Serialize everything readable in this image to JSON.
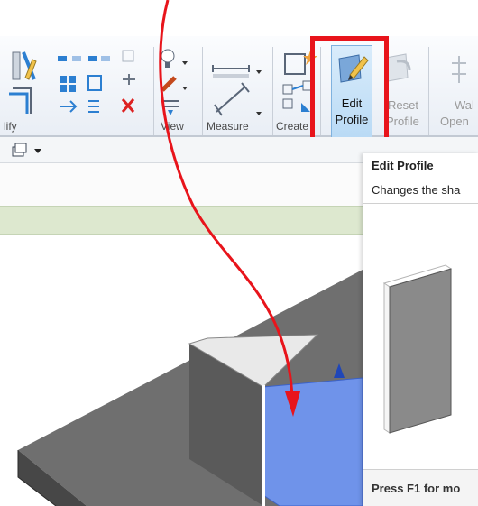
{
  "ribbon": {
    "panels": [
      {
        "label": "lify"
      },
      {
        "label": "View"
      },
      {
        "label": "Measure"
      },
      {
        "label": "Create"
      }
    ],
    "edit_profile": {
      "line1": "Edit",
      "line2": "Profile"
    },
    "reset_profile": {
      "line1": "Reset",
      "line2": "Profile"
    },
    "wall_opening": {
      "line1": "Wal",
      "line2": "Open"
    }
  },
  "tooltip": {
    "title": "Edit Profile",
    "description": "Changes the sha",
    "footer": "Press F1 for mo"
  },
  "colors": {
    "highlight": "#e8141b",
    "arrow": "#e8141b",
    "selected_face": "#6f93ea",
    "button_active": "#b9daf5",
    "options_bar": "#dde8cf"
  }
}
